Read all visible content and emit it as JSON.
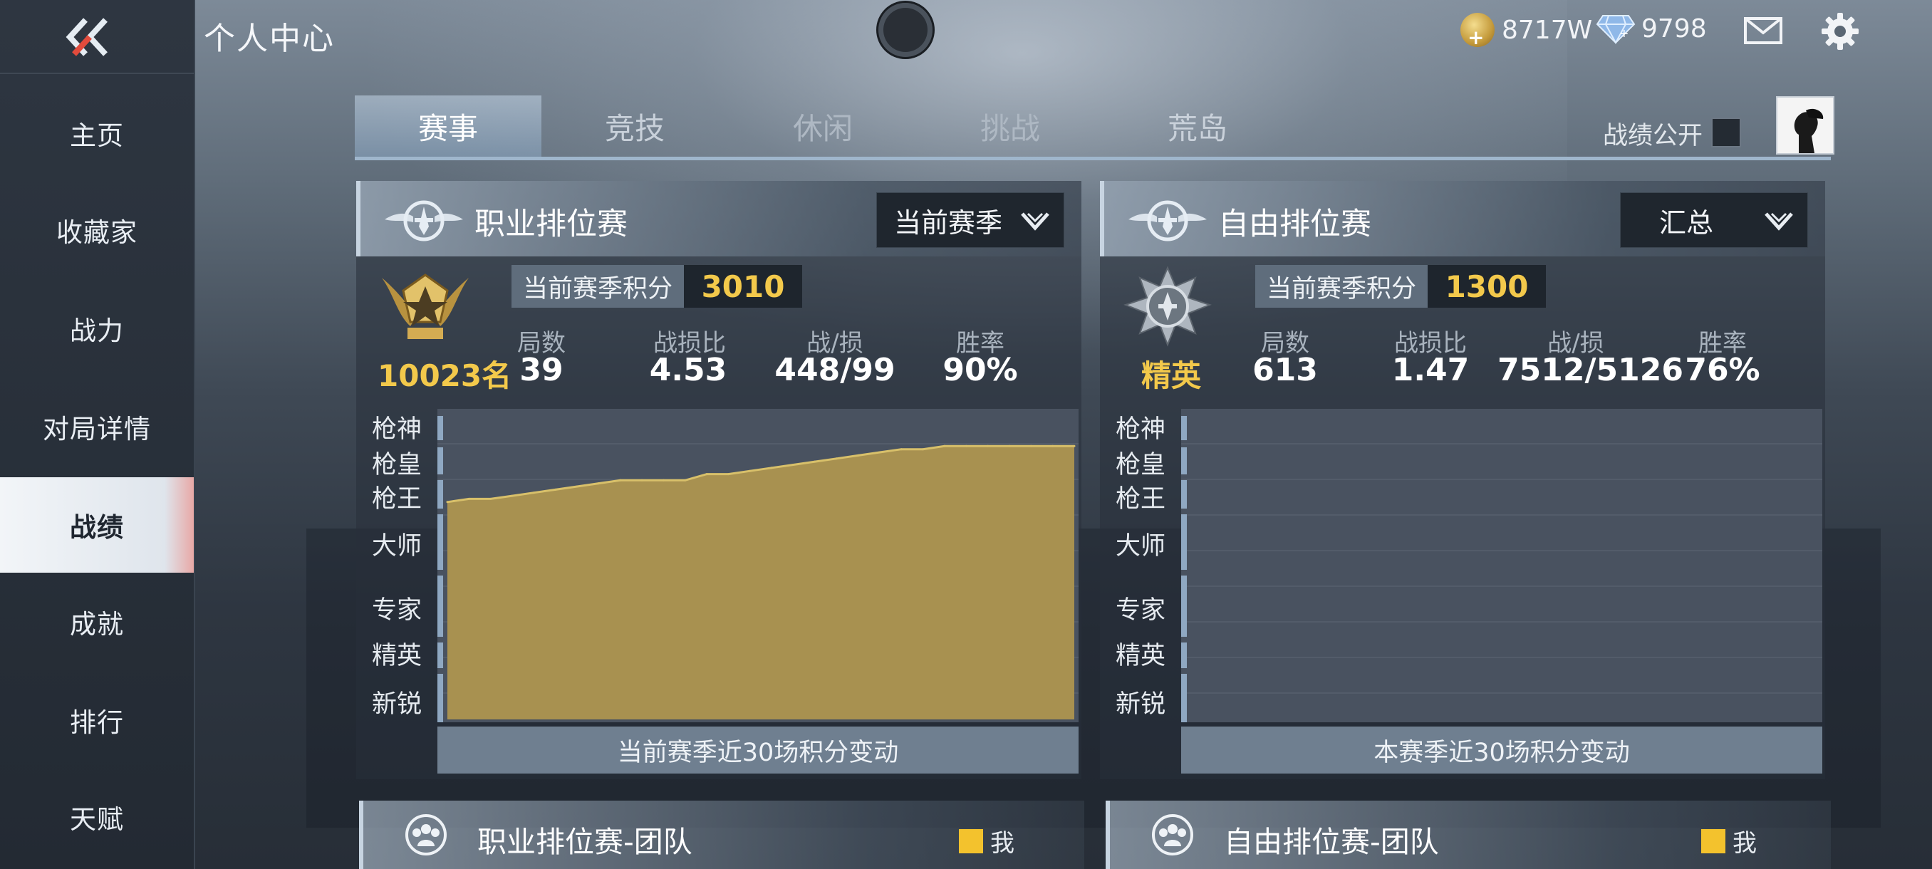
{
  "header": {
    "title": "个人中心",
    "gold": "8717W",
    "diamonds": "9798"
  },
  "sidebar": {
    "items": [
      {
        "label": "主页"
      },
      {
        "label": "收藏家"
      },
      {
        "label": "战力"
      },
      {
        "label": "对局详情"
      },
      {
        "label": "战绩",
        "active": true
      },
      {
        "label": "成就"
      },
      {
        "label": "排行"
      },
      {
        "label": "天赋"
      }
    ]
  },
  "tabs": [
    "赛事",
    "竞技",
    "休闲",
    "挑战",
    "荒岛"
  ],
  "active_tab": "赛事",
  "record_public_label": "战绩公开",
  "record_public_checked": false,
  "colors": {
    "accent_gold": "#f3c94b",
    "chart_fill": "#a89150",
    "chart_line": "#d8c06a"
  },
  "tier_labels": [
    "枪神",
    "枪皇",
    "枪王",
    "大师",
    "专家",
    "精英",
    "新锐"
  ],
  "panels": {
    "pro": {
      "title": "职业排位赛",
      "dropdown": "当前赛季",
      "rank_label": "10023名",
      "score_label": "当前赛季积分",
      "score": "3010",
      "stats": [
        {
          "label": "局数",
          "value": "39"
        },
        {
          "label": "战损比",
          "value": "4.53"
        },
        {
          "label": "战/损",
          "value": "448/99"
        },
        {
          "label": "胜率",
          "value": "90%"
        }
      ],
      "caption": "当前赛季近30场积分变动"
    },
    "free": {
      "title": "自由排位赛",
      "dropdown": "汇总",
      "rank_label": "精英",
      "score_label": "当前赛季积分",
      "score": "1300",
      "stats": [
        {
          "label": "局数",
          "value": "613"
        },
        {
          "label": "战损比",
          "value": "1.47"
        },
        {
          "label": "战/损",
          "value": "7512/5126"
        },
        {
          "label": "胜率",
          "value": "76%"
        }
      ],
      "caption": "本赛季近30场积分变动"
    }
  },
  "teams": {
    "pro": {
      "title": "职业排位赛-团队",
      "legend": "我"
    },
    "free": {
      "title": "自由排位赛-团队",
      "legend": "我"
    }
  },
  "chart_data": {
    "type": "area",
    "title": "",
    "xlabel": "当前赛季近30场积分变动",
    "ylabel": "",
    "y_ticks": [
      "新锐",
      "精英",
      "专家",
      "大师",
      "枪王",
      "枪皇",
      "枪神"
    ],
    "ylim": [
      0,
      1
    ],
    "grid": true,
    "x": [
      1,
      2,
      3,
      4,
      5,
      6,
      7,
      8,
      9,
      10,
      11,
      12,
      13,
      14,
      15,
      16,
      17,
      18,
      19,
      20,
      21,
      22,
      23,
      24,
      25,
      26,
      27,
      28,
      29,
      30
    ],
    "series": [
      {
        "values": [
          0.7,
          0.71,
          0.71,
          0.72,
          0.73,
          0.74,
          0.75,
          0.76,
          0.77,
          0.77,
          0.77,
          0.77,
          0.79,
          0.79,
          0.8,
          0.81,
          0.82,
          0.83,
          0.84,
          0.85,
          0.86,
          0.87,
          0.87,
          0.88,
          0.88,
          0.88,
          0.88,
          0.88,
          0.88,
          0.88
        ]
      }
    ]
  }
}
